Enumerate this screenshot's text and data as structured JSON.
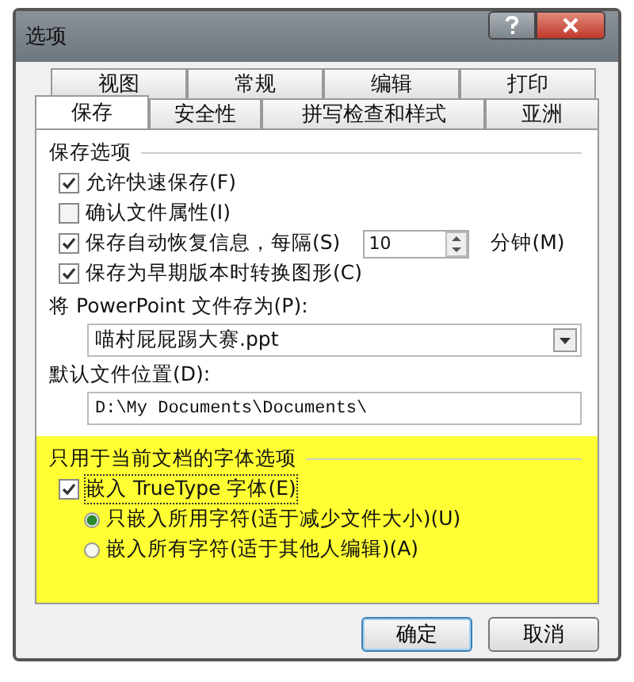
{
  "window": {
    "title": "选项"
  },
  "tab_rows": [
    [
      {
        "label": "视图",
        "selected": false
      },
      {
        "label": "常规",
        "selected": false
      },
      {
        "label": "编辑",
        "selected": false
      },
      {
        "label": "打印",
        "selected": false
      }
    ],
    [
      {
        "label": "保存",
        "selected": true
      },
      {
        "label": "安全性",
        "selected": false
      },
      {
        "label": "拼写检查和样式",
        "selected": false
      },
      {
        "label": "亚洲",
        "selected": false
      }
    ]
  ],
  "save_options": {
    "title": "保存选项",
    "items": [
      {
        "kind": "plain",
        "label": "允许快速保存(F)",
        "checked": true
      },
      {
        "kind": "plain",
        "label": "确认文件属性(I)",
        "checked": false
      },
      {
        "kind": "spin",
        "label": "保存自动恢复信息，每隔(S)",
        "checked": true,
        "value": "10",
        "unit": "分钟(M)"
      },
      {
        "kind": "plain",
        "label": "保存为早期版本时转换图形(C)",
        "checked": true
      }
    ]
  },
  "save_as": {
    "label": "将 PowerPoint 文件存为(P):",
    "value": "喵村屁屁踢大赛.ppt"
  },
  "default_location": {
    "label": "默认文件位置(D):",
    "value": "D:\\My Documents\\Documents\\"
  },
  "font_options": {
    "title": "只用于当前文档的字体选项",
    "embed": {
      "label": "嵌入 TrueType 字体(E)",
      "checked": true
    },
    "radios": [
      {
        "label": "只嵌入所用字符(适于减少文件大小)(U)",
        "selected": true
      },
      {
        "label": "嵌入所有字符(适于其他人编辑)(A)",
        "selected": false
      }
    ]
  },
  "buttons": [
    "确定",
    "取消"
  ]
}
